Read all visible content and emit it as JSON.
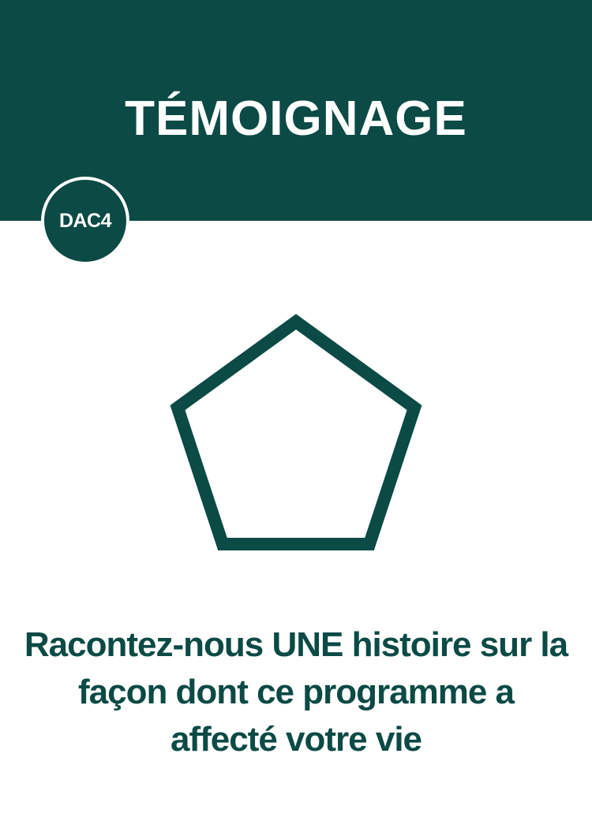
{
  "header": {
    "title": "TÉMOIGNAGE"
  },
  "badge": {
    "label": "DAC4"
  },
  "icon": {
    "name": "pentagon-outline-icon"
  },
  "prompt": {
    "text": "Racontez-nous UNE histoire sur la façon dont ce programme a affecté votre vie"
  },
  "colors": {
    "primary": "#0b4a45",
    "background": "#ffffff",
    "header_text": "#ffffff"
  }
}
